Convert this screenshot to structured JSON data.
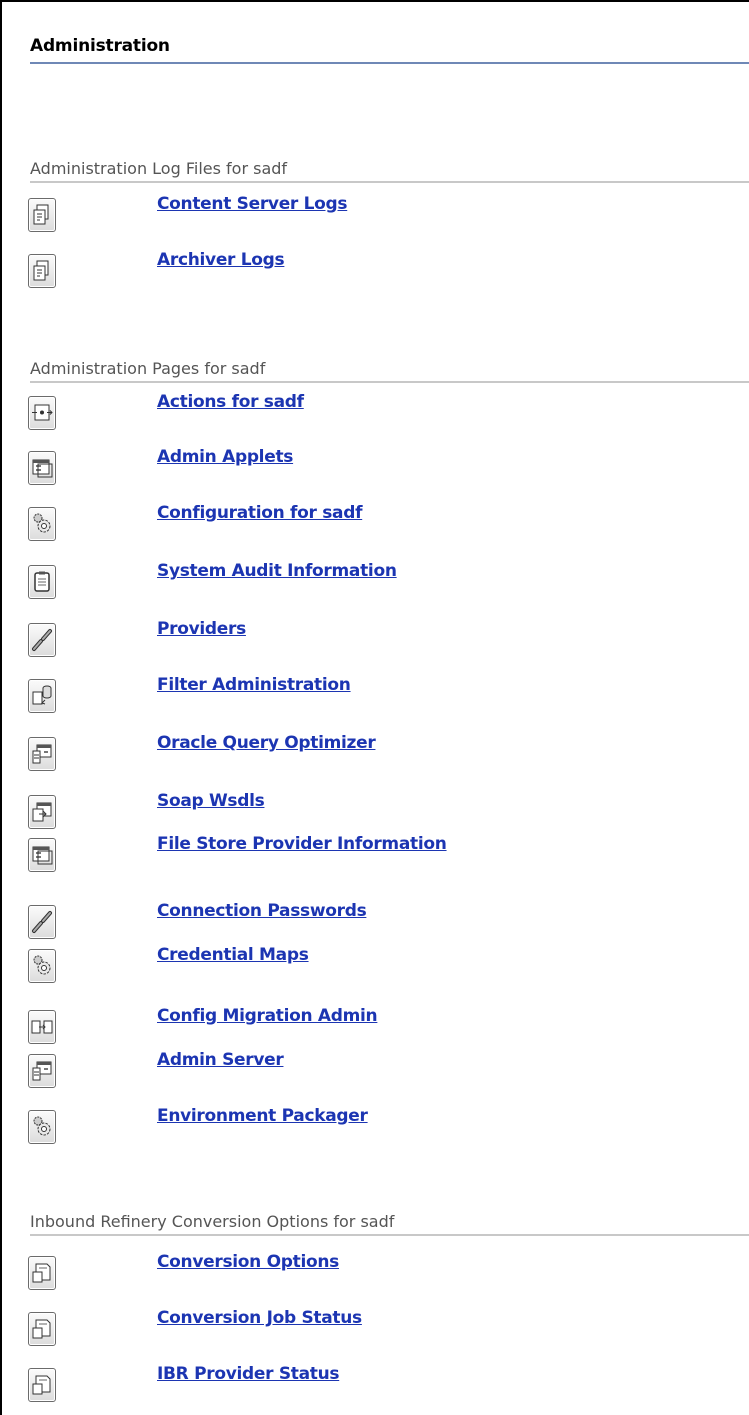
{
  "page": {
    "title": "Administration"
  },
  "sections": [
    {
      "heading": "Administration Log Files for sadf",
      "items": [
        {
          "label": "Content Server Logs",
          "icon": "log-file-icon"
        },
        {
          "label": "Archiver Logs",
          "icon": "log-file-icon"
        }
      ]
    },
    {
      "heading": "Administration Pages for sadf",
      "items": [
        {
          "label": "Actions for sadf",
          "icon": "actions-icon"
        },
        {
          "label": "Admin Applets",
          "icon": "applet-window-icon"
        },
        {
          "label": "Configuration for sadf",
          "icon": "gears-icon"
        },
        {
          "label": "System Audit Information",
          "icon": "clipboard-icon"
        },
        {
          "label": "Providers",
          "icon": "chain-link-icon"
        },
        {
          "label": "Filter Administration",
          "icon": "filter-database-icon"
        },
        {
          "label": "Oracle Query Optimizer",
          "icon": "server-window-icon"
        },
        {
          "label": "Soap Wsdls",
          "icon": "import-window-icon"
        },
        {
          "label": "File Store Provider Information",
          "icon": "applet-window-icon"
        },
        {
          "label": "Connection Passwords",
          "icon": "chain-link-icon"
        },
        {
          "label": "Credential Maps",
          "icon": "gears-icon"
        },
        {
          "label": "Config Migration Admin",
          "icon": "migration-icon"
        },
        {
          "label": "Admin Server",
          "icon": "server-window-icon"
        },
        {
          "label": "Environment Packager",
          "icon": "gears-icon"
        }
      ]
    },
    {
      "heading": "Inbound Refinery Conversion Options for sadf",
      "items": [
        {
          "label": "Conversion Options",
          "icon": "conversion-page-icon"
        },
        {
          "label": "Conversion Job Status",
          "icon": "conversion-page-icon"
        },
        {
          "label": "IBR Provider Status",
          "icon": "conversion-page-icon"
        }
      ]
    }
  ]
}
